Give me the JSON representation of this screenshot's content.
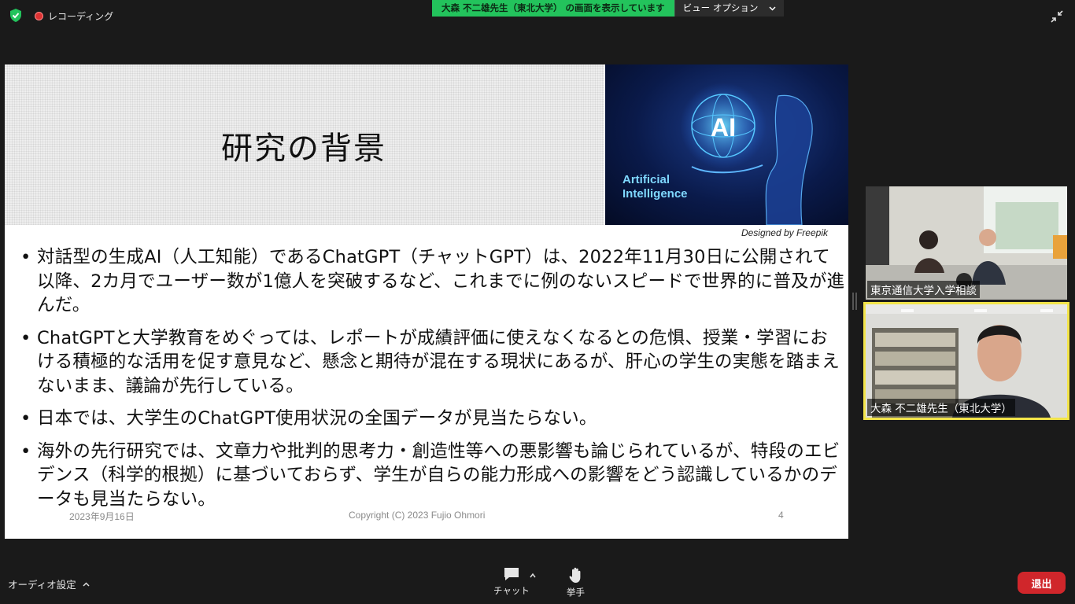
{
  "top_bar": {
    "shield_icon": "shield-check-icon",
    "recording_label": "レコーディング",
    "share_status": "大森 不二雄先生（東北大学） の画面を表示しています",
    "view_options_label": "ビュー オプション",
    "colors": {
      "share_green": "#23c35c"
    }
  },
  "slide": {
    "title": "研究の背景",
    "image_text_line1": "Artificial",
    "image_text_line2": "Intelligence",
    "image_center_text": "AI",
    "credit": "Designed by Freepik",
    "bullets": [
      "対話型の生成AI（人工知能）であるChatGPT（チャットGPT）は、2022年11月30日に公開されて以降、2カ月でユーザー数が1億人を突破するなど、これまでに例のないスピードで世界的に普及が進んだ。",
      "ChatGPTと大学教育をめぐっては、レポートが成績評価に使えなくなるとの危惧、授業・学習における積極的な活用を促す意見など、懸念と期待が混在する現状にあるが、肝心の学生の実態を踏まえないまま、議論が先行している。",
      "日本では、大学生のChatGPT使用状況の全国データが見当たらない。",
      "海外の先行研究では、文章力や批判的思考力・創造性等への悪影響も論じられているが、特段のエビデンス（科学的根拠）に基づいておらず、学生が自らの能力形成への影響をどう認識しているかのデータも見当たらない。"
    ],
    "footer_date": "2023年9月16日",
    "footer_copyright": "Copyright (C) 2023 Fujio Ohmori",
    "page_number": "4"
  },
  "participants": [
    {
      "name": "東京通信大学入学相談",
      "active_speaker": false
    },
    {
      "name": "大森 不二雄先生（東北大学）",
      "active_speaker": true
    }
  ],
  "toolbar": {
    "audio_settings_label": "オーディオ設定",
    "chat_label": "チャット",
    "raise_hand_label": "挙手",
    "leave_label": "退出",
    "colors": {
      "leave_red": "#d0262b",
      "active_speaker_border": "#f2e44a"
    }
  }
}
